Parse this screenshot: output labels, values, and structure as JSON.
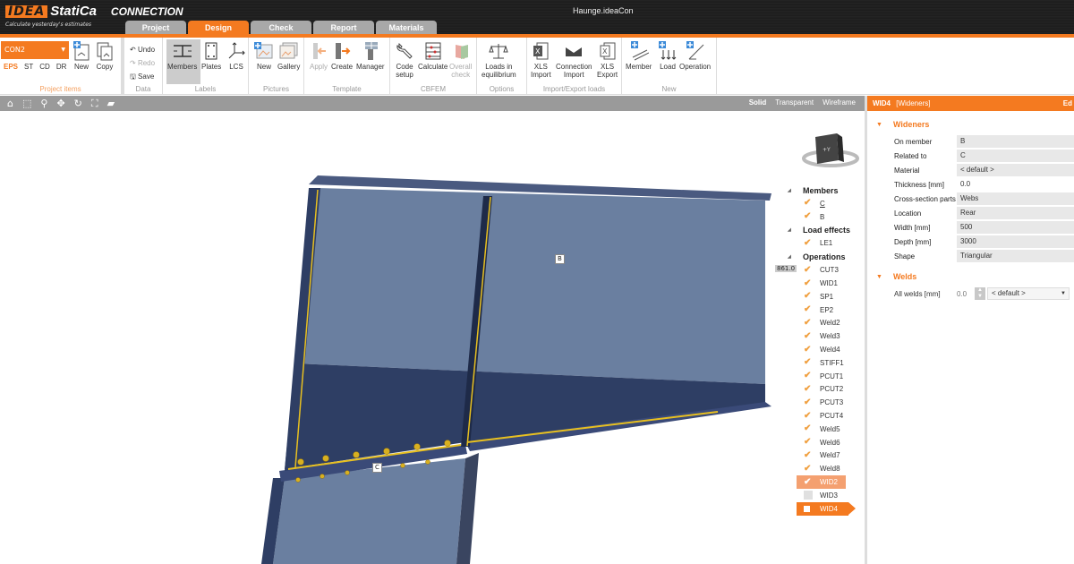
{
  "app": {
    "logo_brand": "IDEA",
    "logo_product": "StatiCa",
    "module": "CONNECTION",
    "tagline": "Calculate yesterday's estimates",
    "document_title": "Haunge.ideaCon"
  },
  "tabs": [
    {
      "label": "Project",
      "active": false
    },
    {
      "label": "Design",
      "active": true
    },
    {
      "label": "Check",
      "active": false
    },
    {
      "label": "Report",
      "active": false
    },
    {
      "label": "Materials",
      "active": false
    }
  ],
  "ribbon": {
    "project_items": {
      "label": "Project items",
      "connection_select": "CON2",
      "links": [
        "EPS",
        "ST",
        "CD",
        "DR"
      ],
      "new_label": "New",
      "copy_label": "Copy"
    },
    "data": {
      "label": "Data",
      "undo": "Undo",
      "redo": "Redo",
      "save": "Save"
    },
    "labels": {
      "label": "Labels",
      "members": "Members",
      "plates": "Plates",
      "lcs": "LCS"
    },
    "pictures": {
      "label": "Pictures",
      "new": "New",
      "gallery": "Gallery"
    },
    "template": {
      "label": "Template",
      "apply": "Apply",
      "create": "Create",
      "manager": "Manager"
    },
    "cbfem": {
      "label": "CBFEM",
      "code_setup_1": "Code",
      "code_setup_2": "setup",
      "calculate": "Calculate",
      "overall_1": "Overall",
      "overall_2": "check"
    },
    "options": {
      "label": "Options",
      "loads_1": "Loads in",
      "loads_2": "equilibrium"
    },
    "import_export": {
      "label": "Import/Export loads",
      "xls_import_1": "XLS",
      "xls_import_2": "Import",
      "conn_import_1": "Connection",
      "conn_import_2": "Import",
      "xls_export_1": "XLS",
      "xls_export_2": "Export"
    },
    "new": {
      "label": "New",
      "member": "Member",
      "load": "Load",
      "operation": "Operation"
    }
  },
  "viewbar": {
    "modes": [
      "Solid",
      "Transparent",
      "Wireframe"
    ],
    "active_mode": "Solid"
  },
  "viewport": {
    "member_label_b": "B",
    "member_label_c": "C",
    "dimension": "861.0",
    "cube_face": "+Y"
  },
  "tree": {
    "members_header": "Members",
    "members": [
      {
        "label": "C",
        "checked": true
      },
      {
        "label": "B",
        "checked": true
      }
    ],
    "load_effects_header": "Load effects",
    "load_effects": [
      {
        "label": "LE1",
        "checked": true
      }
    ],
    "operations_header": "Operations",
    "operations": [
      {
        "label": "CUT3",
        "checked": true
      },
      {
        "label": "WID1",
        "checked": true
      },
      {
        "label": "SP1",
        "checked": true
      },
      {
        "label": "EP2",
        "checked": true
      },
      {
        "label": "Weld2",
        "checked": true
      },
      {
        "label": "Weld3",
        "checked": true
      },
      {
        "label": "Weld4",
        "checked": true
      },
      {
        "label": "STIFF1",
        "checked": true
      },
      {
        "label": "PCUT1",
        "checked": true
      },
      {
        "label": "PCUT2",
        "checked": true
      },
      {
        "label": "PCUT3",
        "checked": true
      },
      {
        "label": "PCUT4",
        "checked": true
      },
      {
        "label": "Weld5",
        "checked": true
      },
      {
        "label": "Weld6",
        "checked": true
      },
      {
        "label": "Weld7",
        "checked": true
      },
      {
        "label": "Weld8",
        "checked": true
      },
      {
        "label": "WID2",
        "checked": true
      },
      {
        "label": "WID3",
        "checked": false
      },
      {
        "label": "WID4",
        "checked": false
      }
    ]
  },
  "panel": {
    "title": "WID4",
    "subtitle": "[Wideners]",
    "edit_label": "Ed",
    "wideners_header": "Wideners",
    "properties": [
      {
        "label": "On member",
        "value": "B"
      },
      {
        "label": "Related to",
        "value": "C"
      },
      {
        "label": "Material",
        "value": "< default >"
      },
      {
        "label": "Thickness [mm]",
        "value": "0.0"
      },
      {
        "label": "Cross-section parts",
        "value": "Webs"
      },
      {
        "label": "Location",
        "value": "Rear"
      },
      {
        "label": "Width [mm]",
        "value": "500"
      },
      {
        "label": "Depth [mm]",
        "value": "3000"
      },
      {
        "label": "Shape",
        "value": "Triangular"
      }
    ],
    "welds_header": "Welds",
    "all_welds_label": "All welds [mm]",
    "all_welds_value": "0.0",
    "all_welds_type": "< default >"
  },
  "colors": {
    "accent": "#f47a20",
    "steel_light": "#6a7fa0",
    "steel_dark": "#2e3e64",
    "weld": "#e8c020"
  }
}
